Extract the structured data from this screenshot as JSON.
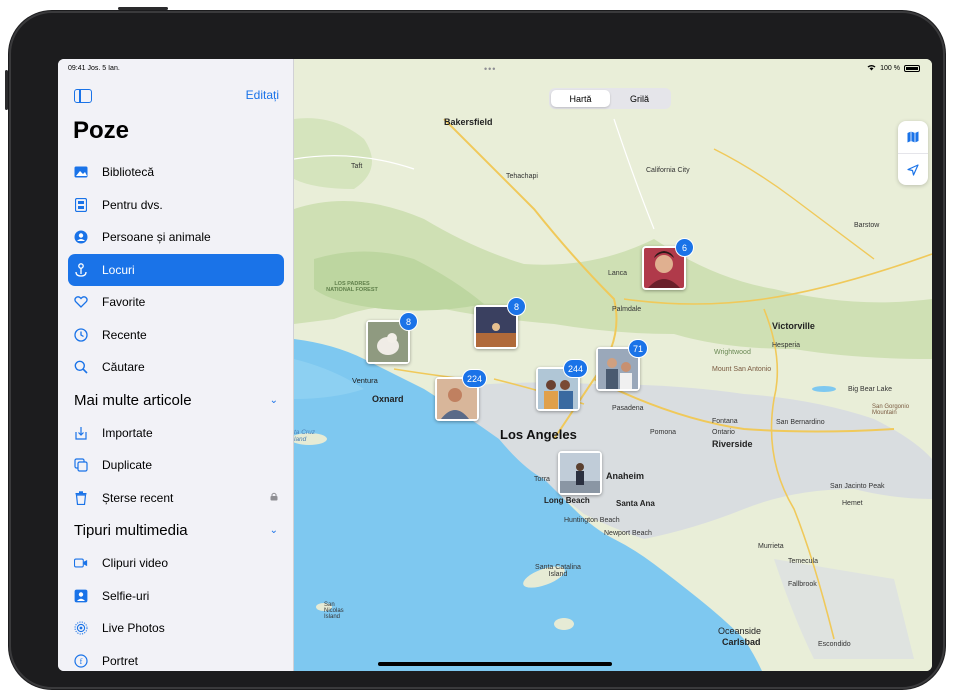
{
  "status": {
    "time": "09:41",
    "date": "Jos. 5 Ian.",
    "battery": "100 %"
  },
  "sidebar": {
    "edit_label": "Editați",
    "title": "Poze",
    "items": [
      {
        "label": "Bibliotecă",
        "icon": "photo-library-icon"
      },
      {
        "label": "Pentru dvs.",
        "icon": "for-you-icon"
      },
      {
        "label": "Persoane și animale",
        "icon": "people-icon"
      },
      {
        "label": "Locuri",
        "icon": "places-icon",
        "selected": true
      },
      {
        "label": "Favorite",
        "icon": "heart-icon"
      },
      {
        "label": "Recente",
        "icon": "clock-icon"
      },
      {
        "label": "Căutare",
        "icon": "search-icon"
      }
    ],
    "section_more": "Mai multe articole",
    "more_items": [
      {
        "label": "Importate",
        "icon": "import-icon"
      },
      {
        "label": "Duplicate",
        "icon": "duplicate-icon"
      },
      {
        "label": "Șterse recent",
        "icon": "trash-icon",
        "locked": true
      }
    ],
    "section_media": "Tipuri multimedia",
    "media_items": [
      {
        "label": "Clipuri video",
        "icon": "video-icon"
      },
      {
        "label": "Selfie-uri",
        "icon": "selfie-icon"
      },
      {
        "label": "Live Photos",
        "icon": "live-photo-icon"
      },
      {
        "label": "Portret",
        "icon": "portrait-icon"
      }
    ]
  },
  "map": {
    "segments": [
      "Hartă",
      "Grilă"
    ],
    "active_segment": "Hartă",
    "labels": {
      "bakersfield": "Bakersfield",
      "taft": "Taft",
      "tehachapi": "Tehachapi",
      "california_city": "California City",
      "barstow": "Barstow",
      "lancaster": "Lanca",
      "palmdale": "Palmdale",
      "victorville": "Victorville",
      "hesperia": "Hesperia",
      "los_padres": "LOS PADRES NATIONAL FOREST",
      "ventura": "Ventura",
      "oxnard": "Oxnard",
      "los_angeles": "Los Angeles",
      "pasadena": "Pasadena",
      "pomona": "Pomona",
      "ontario": "Ontario",
      "fontana": "Fontana",
      "san_bernardino": "San Bernardino",
      "riverside": "Riverside",
      "anaheim": "Anaheim",
      "torrance": "Torra",
      "long_beach": "Long Beach",
      "santa_ana": "Santa Ana",
      "huntington_beach": "Huntington Beach",
      "newport_beach": "Newport Beach",
      "murrieta": "Murrieta",
      "temecula": "Temecula",
      "fallbrook": "Fallbrook",
      "oceanside": "Oceanside",
      "carlsbad": "Carlsbad",
      "escondido": "Escondido",
      "hemet": "Hemet",
      "san_jacinto": "San Jacinto Peak",
      "big_bear": "Big Bear Lake",
      "mount_san_antonio": "Mount San Antonio",
      "santa_cruz": "ta Cruz land",
      "santa_catalina": "Santa Catalina Island",
      "san_nicolas": "San Nicolas Island",
      "wrightwood": "Wrightwood",
      "san_gorgonio": "San Gorgonio Mountain"
    },
    "clusters": [
      {
        "count": "6",
        "color": "#b03a4a"
      },
      {
        "count": "8",
        "color": "#9aa096"
      },
      {
        "count": "8",
        "color": "#4b3a44"
      },
      {
        "count": "224",
        "color": "#c4866c"
      },
      {
        "count": "244",
        "color": "#8a6f5e"
      },
      {
        "count": "71",
        "color": "#7a7f90"
      },
      {
        "count": "",
        "color": "#7d8a9a"
      }
    ]
  },
  "colors": {
    "accent": "#1a73e8",
    "land": "#e8efd6",
    "water": "#7ec8f0",
    "urban": "#dcdfe2"
  }
}
